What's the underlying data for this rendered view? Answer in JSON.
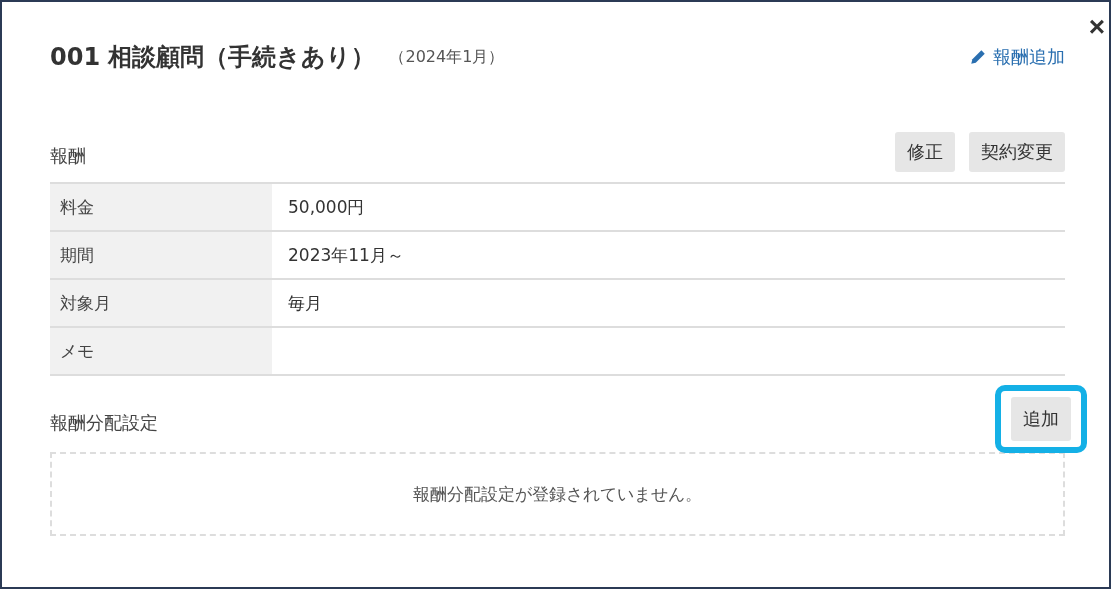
{
  "dialog": {
    "title": "001 相談顧問（手続きあり）",
    "subtitle": "（2024年1月）",
    "close": "×",
    "add_link": "報酬追加"
  },
  "fee": {
    "heading": "報酬",
    "buttons": [
      "修正",
      "契約変更"
    ],
    "rows": [
      {
        "label": "料金",
        "value": "50,000円"
      },
      {
        "label": "期間",
        "value": "2023年11月～"
      },
      {
        "label": "対象月",
        "value": "毎月"
      },
      {
        "label": "メモ",
        "value": ""
      }
    ]
  },
  "distribution": {
    "heading": "報酬分配設定",
    "button": "追加",
    "highlighted": true,
    "empty_message": "報酬分配設定が登録されていません。"
  }
}
